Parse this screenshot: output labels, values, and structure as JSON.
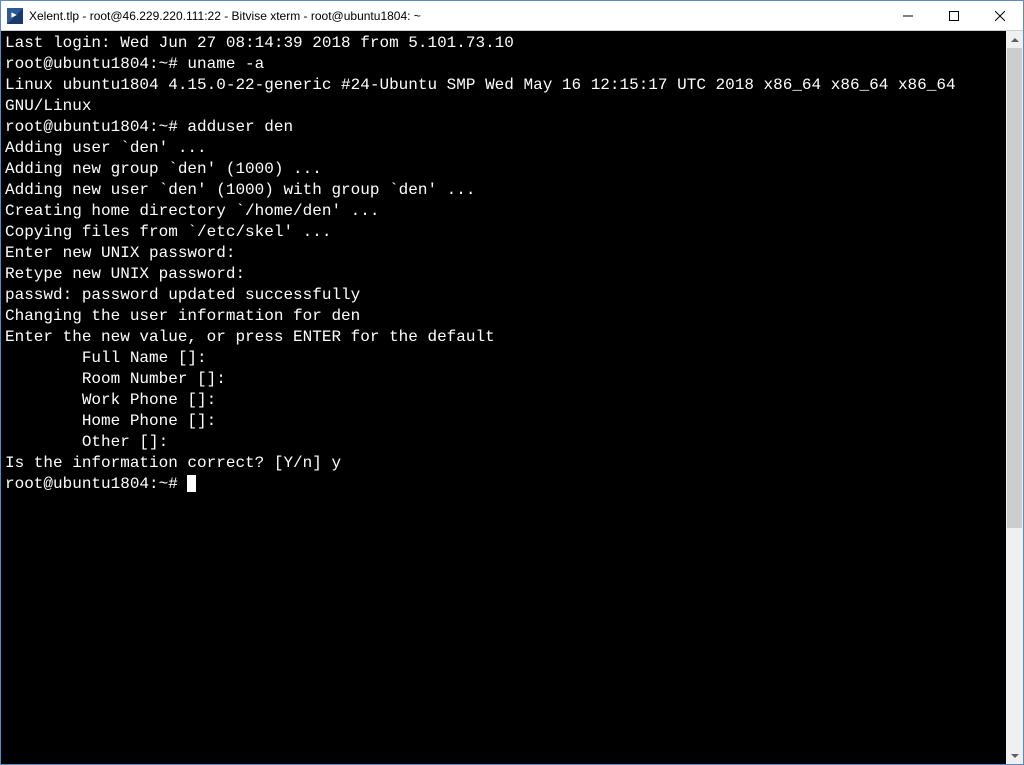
{
  "window": {
    "title": "Xelent.tlp - root@46.229.220.111:22 - Bitvise xterm - root@ubuntu1804: ~"
  },
  "terminal": {
    "lines": [
      "Last login: Wed Jun 27 08:14:39 2018 from 5.101.73.10",
      "root@ubuntu1804:~# uname -a",
      "Linux ubuntu1804 4.15.0-22-generic #24-Ubuntu SMP Wed May 16 12:15:17 UTC 2018 x86_64 x86_64 x86_64",
      "GNU/Linux",
      "root@ubuntu1804:~# adduser den",
      "Adding user `den' ...",
      "Adding new group `den' (1000) ...",
      "Adding new user `den' (1000) with group `den' ...",
      "Creating home directory `/home/den' ...",
      "Copying files from `/etc/skel' ...",
      "Enter new UNIX password:",
      "Retype new UNIX password:",
      "passwd: password updated successfully",
      "Changing the user information for den",
      "Enter the new value, or press ENTER for the default",
      "        Full Name []:",
      "        Room Number []:",
      "        Work Phone []:",
      "        Home Phone []:",
      "        Other []:",
      "Is the information correct? [Y/n] y"
    ],
    "prompt": "root@ubuntu1804:~# "
  }
}
